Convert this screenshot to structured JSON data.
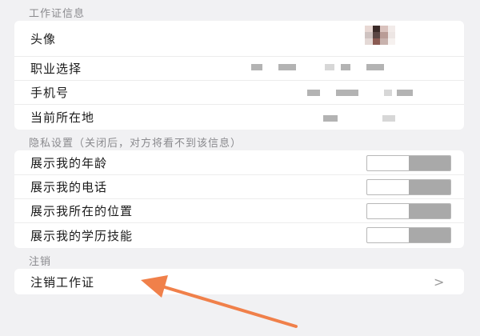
{
  "badge_info": {
    "header": "工作证信息",
    "avatar_label": "头像",
    "occupation_label": "职业选择",
    "phone_label": "手机号",
    "location_label": "当前所在地"
  },
  "privacy": {
    "header": "隐私设置（关闭后，对方将看不到该信息）",
    "items": [
      {
        "label": "展示我的年龄",
        "enabled": false
      },
      {
        "label": "展示我的电话",
        "enabled": false
      },
      {
        "label": "展示我所在的位置",
        "enabled": false
      },
      {
        "label": "展示我的学历技能",
        "enabled": false
      }
    ]
  },
  "cancel": {
    "header": "注销",
    "item_label": "注销工作证",
    "chevron": ">"
  },
  "colors": {
    "background": "#f1f1f3",
    "card": "#ffffff",
    "arrow": "#f0804a",
    "toggle_off": "#a9a9a9"
  }
}
